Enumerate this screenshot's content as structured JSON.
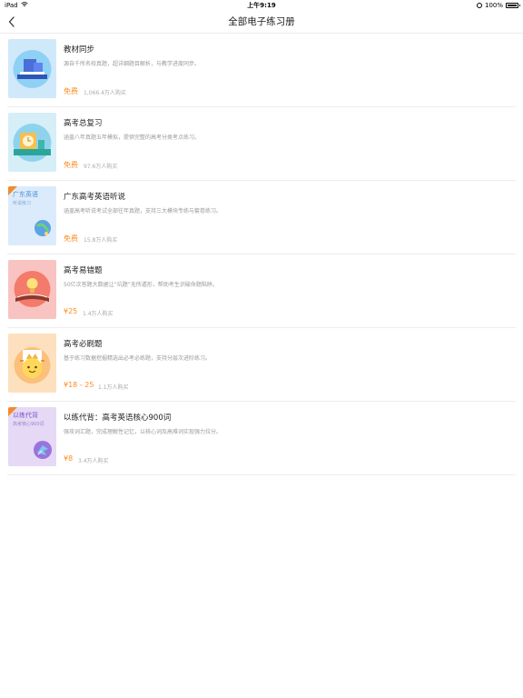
{
  "status_bar": {
    "device": "iPad",
    "time": "上午9:19",
    "battery": "100%"
  },
  "nav": {
    "title": "全部电子练习册"
  },
  "items": [
    {
      "title": "教材同步",
      "desc": "源自千所名校真题，超详细题目解析，与教学进度同步。",
      "price": "免费",
      "buyers": "1,066.4万人购买",
      "cover_color": "#cfe9fb"
    },
    {
      "title": "高考总复习",
      "desc": "涵盖八年真题五年模拟，提供完整的高考分类考点练习。",
      "price": "免费",
      "buyers": "97.6万人购买",
      "cover_color": "#d5eef8"
    },
    {
      "title": "广东高考英语听说",
      "desc": "涵盖高考听说考试全部往年真题，支持三大模块专练与套卷练习。",
      "price": "免费",
      "buyers": "15.8万人购买",
      "cover_color": "#dcebfb",
      "cover_label": "广东英语",
      "cover_sublabel": "听说练习"
    },
    {
      "title": "高考易错题",
      "desc": "50亿次答题大数据让“坑题”无所遁形，帮助考生识破命题陷阱。",
      "price": "¥25",
      "buyers": "1.4万人购买",
      "cover_color": "#f8c3c0"
    },
    {
      "title": "高考必刷题",
      "desc": "基于练习数据挖掘精选出必考必练题，支持分层次进阶练习。",
      "price": "¥18 - 25",
      "buyers": "1.1万人购买",
      "cover_color": "#fde0bd"
    },
    {
      "title": "以练代背：高考英语核心900词",
      "desc": "强攻词汇题，完成理解性记忆，以核心词及高难词实现强力拉分。",
      "price": "¥8",
      "buyers": "3.4万人购买",
      "cover_color": "#e6d9f6",
      "cover_label": "以练代背",
      "cover_sublabel": "高考核心900词"
    }
  ]
}
